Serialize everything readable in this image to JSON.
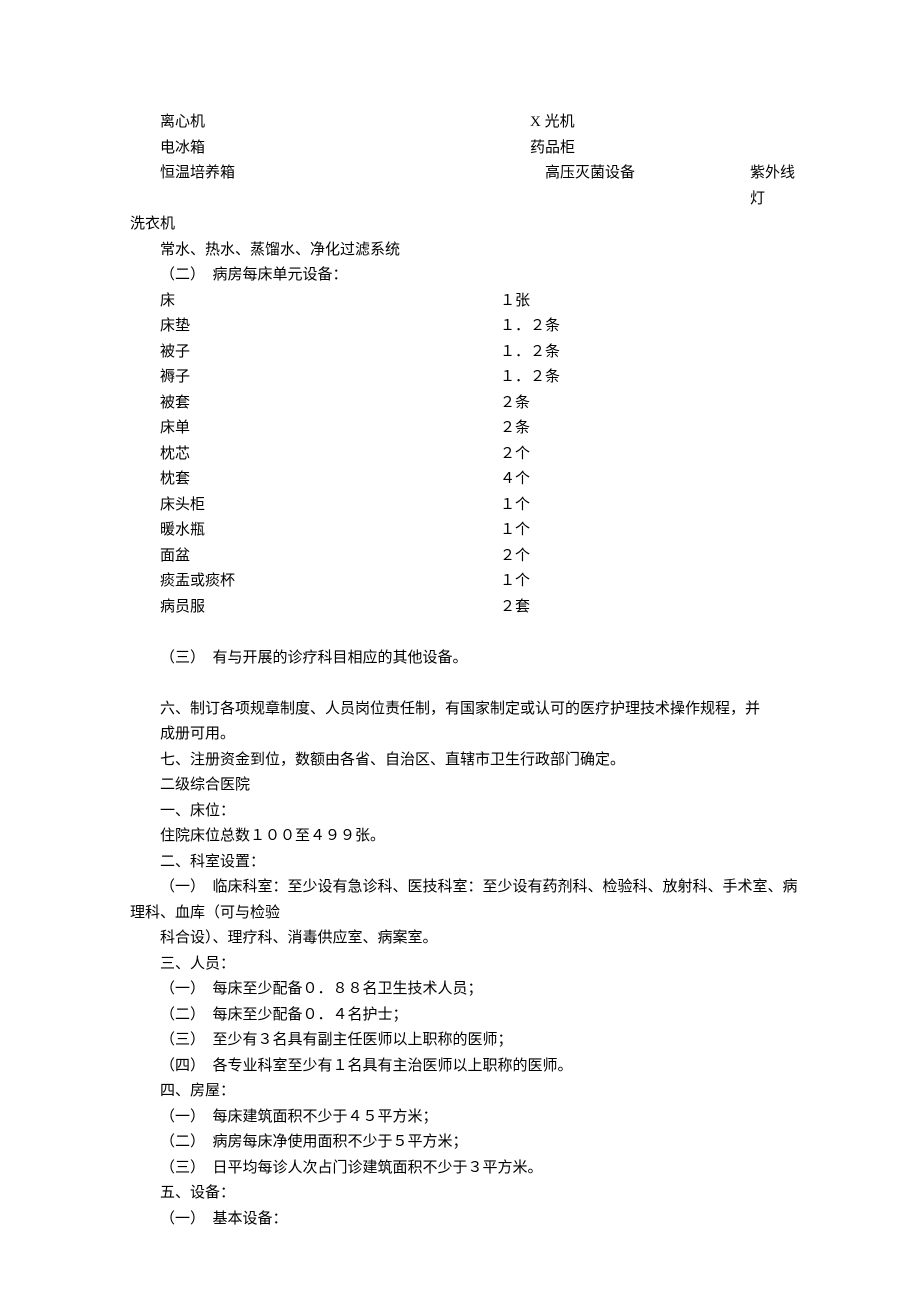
{
  "eq1": [
    {
      "a": "离心机",
      "b": "X 光机",
      "c": ""
    },
    {
      "a": "电冰箱",
      "b": "药品柜",
      "c": ""
    },
    {
      "a": "恒温培养箱",
      "b": "　高压灭菌设备",
      "c": "紫外线灯"
    }
  ],
  "eq1_tail1": "洗衣机",
  "eq1_tail2": "常水、热水、蒸馏水、净化过滤系统",
  "sec2_title": "（二）　病房每床单元设备：",
  "sec2_items": [
    {
      "a": "床",
      "b": "１张"
    },
    {
      "a": "床垫",
      "b": "１．２条"
    },
    {
      "a": "被子",
      "b": "１．２条"
    },
    {
      "a": "褥子",
      "b": "１．２条"
    },
    {
      "a": "被套",
      "b": "２条"
    },
    {
      "a": "床单",
      "b": "２条"
    },
    {
      "a": "枕芯",
      "b": "２个"
    },
    {
      "a": "枕套",
      "b": "４个"
    },
    {
      "a": "床头柜",
      "b": "１个"
    },
    {
      "a": "暖水瓶",
      "b": "１个"
    },
    {
      "a": "面盆",
      "b": "２个"
    },
    {
      "a": "痰盂或痰杯",
      "b": "１个"
    },
    {
      "a": "病员服",
      "b": "２套"
    }
  ],
  "sec3": "（三）　有与开展的诊疗科目相应的其他设备。",
  "p6a": "六、制订各项规章制度、人员岗位责任制，有国家制定或认可的医疗护理技术操作规程，并",
  "p6b": "成册可用。",
  "p7": "七、注册资金到位，数额由各省、自治区、直辖市卫生行政部门确定。",
  "h2": "二级综合医院",
  "t1_h": "一、床位：",
  "t1_1": "住院床位总数１００至４９９张。",
  "t2_h": "二、科室设置：",
  "t2_1": "（一）　临床科室：至少设有急诊科、医技科室：至少设有药剂科、检验科、放射科、手术室、病理科、血库（可与检验",
  "t2_2": "科合设）、理疗科、消毒供应室、病案室。",
  "t3_h": "三、人员：",
  "t3_1": "（一）　每床至少配备０．８８名卫生技术人员；",
  "t3_2": "（二）　每床至少配备０．４名护士；",
  "t3_3": "（三）　至少有３名具有副主任医师以上职称的医师；",
  "t3_4": "（四）　各专业科室至少有１名具有主治医师以上职称的医师。",
  "t4_h": "四、房屋：",
  "t4_1": "（一）　每床建筑面积不少于４５平方米；",
  "t4_2": "（二）　病房每床净使用面积不少于５平方米；",
  "t4_3": "（三）　日平均每诊人次占门诊建筑面积不少于３平方米。",
  "t5_h": "五、设备：",
  "t5_1": "（一）　基本设备："
}
